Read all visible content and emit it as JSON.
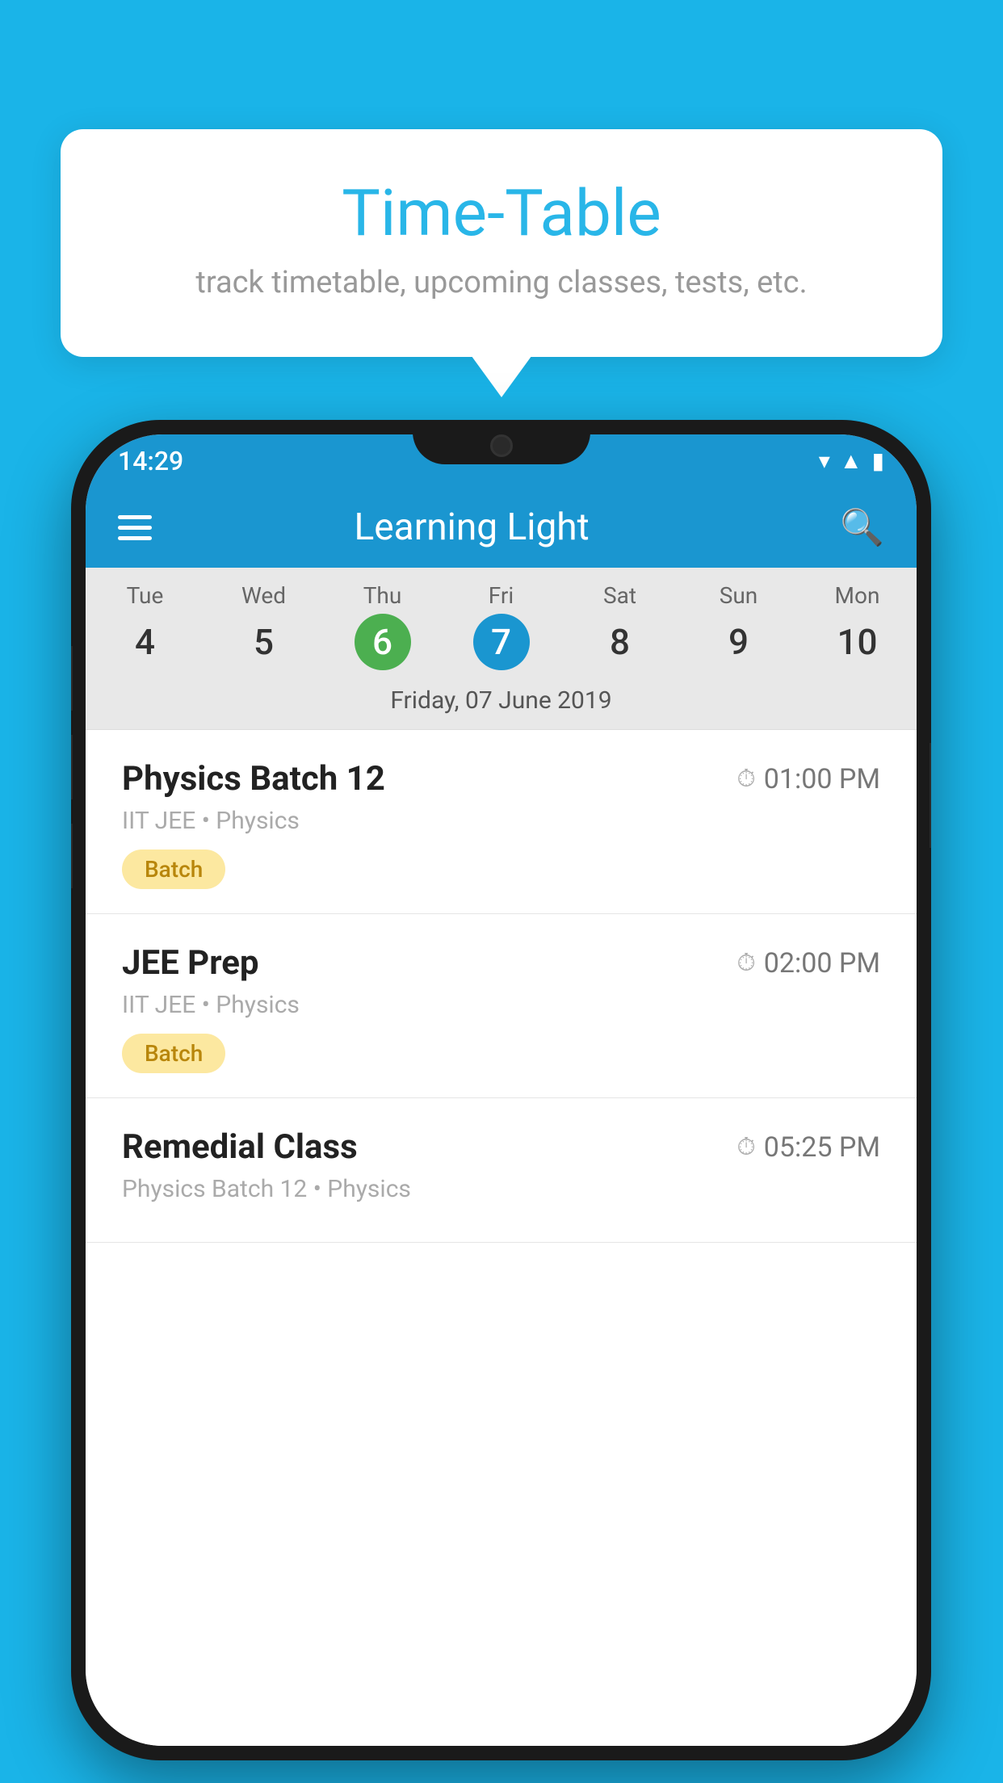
{
  "background_color": "#1ab4e8",
  "tooltip": {
    "title": "Time-Table",
    "subtitle": "track timetable, upcoming classes, tests, etc."
  },
  "phone": {
    "status_bar": {
      "time": "14:29"
    },
    "app_bar": {
      "title": "Learning Light"
    },
    "calendar": {
      "days": [
        {
          "name": "Tue",
          "number": "4",
          "state": "normal"
        },
        {
          "name": "Wed",
          "number": "5",
          "state": "normal"
        },
        {
          "name": "Thu",
          "number": "6",
          "state": "today"
        },
        {
          "name": "Fri",
          "number": "7",
          "state": "selected"
        },
        {
          "name": "Sat",
          "number": "8",
          "state": "normal"
        },
        {
          "name": "Sun",
          "number": "9",
          "state": "normal"
        },
        {
          "name": "Mon",
          "number": "10",
          "state": "normal"
        }
      ],
      "selected_date_label": "Friday, 07 June 2019"
    },
    "schedule": [
      {
        "title": "Physics Batch 12",
        "time": "01:00 PM",
        "meta": "IIT JEE • Physics",
        "badge": "Batch"
      },
      {
        "title": "JEE Prep",
        "time": "02:00 PM",
        "meta": "IIT JEE • Physics",
        "badge": "Batch"
      },
      {
        "title": "Remedial Class",
        "time": "05:25 PM",
        "meta": "Physics Batch 12 • Physics",
        "badge": ""
      }
    ]
  }
}
